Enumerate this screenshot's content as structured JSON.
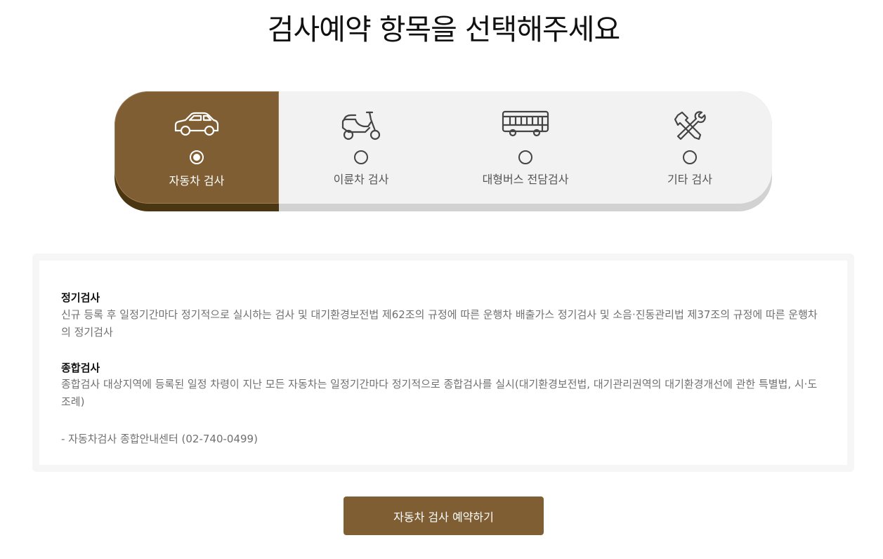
{
  "page": {
    "title": "검사예약 항목을 선택해주세요"
  },
  "colors": {
    "accent": "#7f5e33",
    "accent_shadow": "#4a3610",
    "selector_bg": "#f2f2f2",
    "selector_shadow": "#d2d2d2"
  },
  "selector": {
    "selected": "car",
    "options": [
      {
        "key": "car",
        "label": "자동차 검사",
        "icon": "car-icon",
        "selected": true
      },
      {
        "key": "scooter",
        "label": "이륜차 검사",
        "icon": "scooter-icon",
        "selected": false
      },
      {
        "key": "bus",
        "label": "대형버스 전담검사",
        "icon": "bus-icon",
        "selected": false
      },
      {
        "key": "other",
        "label": "기타 검사",
        "icon": "tools-icon",
        "selected": false
      }
    ]
  },
  "info": {
    "sections": [
      {
        "heading": "정기검사",
        "description": "신규 등록 후 일정기간마다 정기적으로 실시하는 검사 및 대기환경보전법 제62조의 규정에 따른 운행차 배출가스 정기검사 및 소음·진동관리법 제37조의 규정에 따른 운행차의 정기검사"
      },
      {
        "heading": "종합검사",
        "description": "종합검사 대상지역에 등록된 일정 차령이 지난 모든 자동차는 일정기간마다 정기적으로 종합검사를 실시(대기환경보전법, 대기관리권역의 대기환경개선에 관한 특별법, 시·도 조례)"
      }
    ],
    "contact": "- 자동차검사 종합안내센터 (02-740-0499)"
  },
  "cta": {
    "label": "자동차 검사 예약하기"
  }
}
